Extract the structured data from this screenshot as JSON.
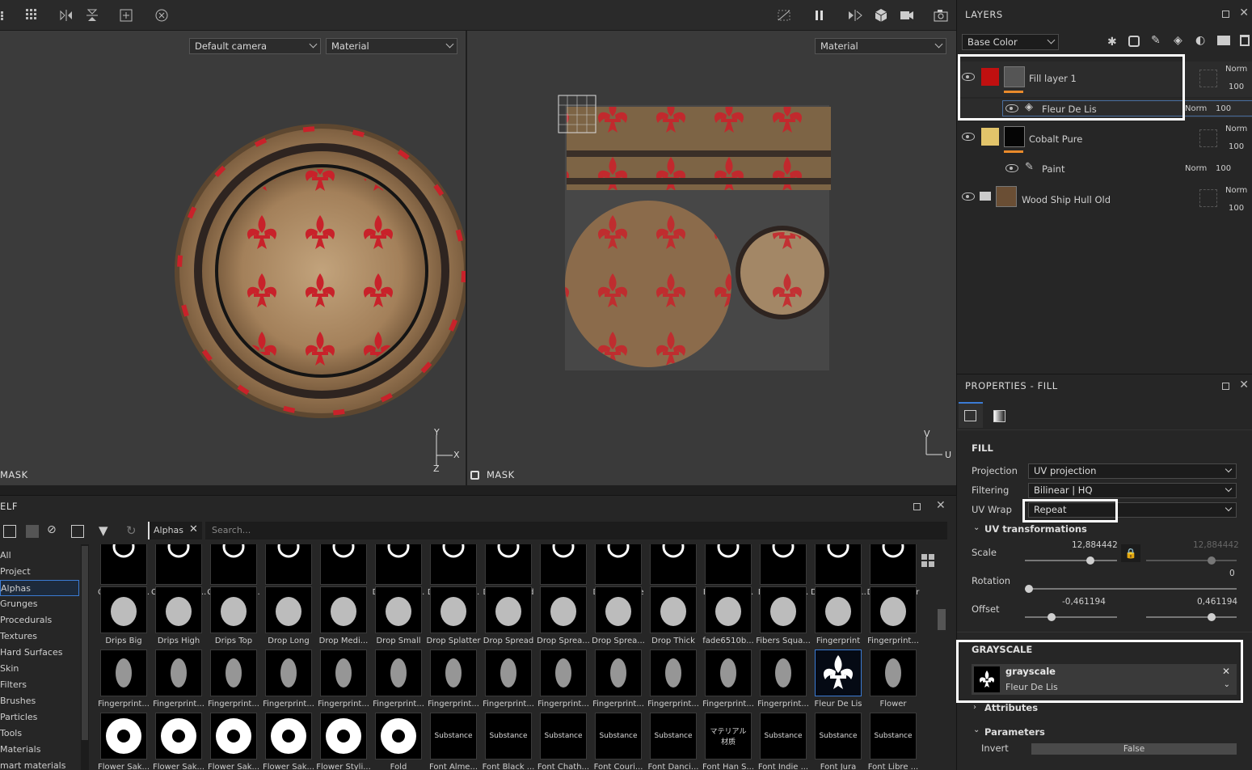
{
  "viewport_left": {
    "camera_select": "Default camera",
    "channel_select": "Material",
    "mask_label": "MASK",
    "axis": {
      "y": "Y",
      "x": "X",
      "z": "Z"
    }
  },
  "viewport_right": {
    "channel_select": "Material",
    "mask_label": "MASK",
    "axis": {
      "v": "V",
      "u": "U"
    }
  },
  "layers": {
    "title": "LAYERS",
    "channel_select": "Base Color",
    "items": [
      {
        "name": "Fill layer 1",
        "blend": "Norm",
        "opacity": "100",
        "color": "#c01010"
      },
      {
        "name": "Fleur De Lis",
        "blend": "Norm",
        "opacity": "100",
        "type": "fill-effect"
      },
      {
        "name": "Cobalt Pure",
        "blend": "Norm",
        "opacity": "100",
        "color": "#e2c46a"
      },
      {
        "name": "Paint",
        "blend": "Norm",
        "opacity": "100",
        "type": "paint-effect"
      },
      {
        "name": "Wood Ship Hull Old",
        "blend": "Norm",
        "opacity": "100",
        "type": "folder"
      }
    ]
  },
  "properties": {
    "title": "PROPERTIES - FILL",
    "fill_section": "FILL",
    "projection_label": "Projection",
    "projection_value": "UV projection",
    "filtering_label": "Filtering",
    "filtering_value": "Bilinear | HQ",
    "uvwrap_label": "UV Wrap",
    "uvwrap_value": "Repeat",
    "uvtrans_label": "UV transformations",
    "scale_label": "Scale",
    "scale_value": "12,884442",
    "scale_value2": "12,884442",
    "rotation_label": "Rotation",
    "rotation_value": "0",
    "offset_label": "Offset",
    "offset_x": "-0,461194",
    "offset_y": "0,461194",
    "grayscale_section": "GRAYSCALE",
    "grayscale_name": "grayscale",
    "grayscale_resource": "Fleur De Lis",
    "attributes_label": "Attributes",
    "parameters_label": "Parameters",
    "invert_label": "Invert",
    "invert_value": "False"
  },
  "shelf": {
    "title": "ELF",
    "filter_tag": "Alphas",
    "search_placeholder": "Search...",
    "categories": [
      "All",
      "Project",
      "Alphas",
      "Grunges",
      "Procedurals",
      "Textures",
      "Hard Surfaces",
      "Skin",
      "Filters",
      "Brushes",
      "Particles",
      "Tools",
      "Materials",
      "mart materials"
    ],
    "selected_category": "Alphas",
    "rows": [
      [
        "Cross Medi...",
        "Cross Recta...",
        "Cross Roun...",
        "Cross Split",
        "Cross Thin",
        "Diagonal D...",
        "Dirt Blurry ...",
        "Dirt Brushed",
        "Dirt Cloudy",
        "Dirt Smudge",
        "Dirt Spots",
        "Dirt Spots ...",
        "Dirt Spots ...",
        "Dirt Stain la...",
        "Dots Circular"
      ],
      [
        "Drips Big",
        "Drips High",
        "Drips Top",
        "Drop Long",
        "Drop Medi...",
        "Drop Small",
        "Drop Splatter",
        "Drop Spread",
        "Drop Sprea...",
        "Drop Sprea...",
        "Drop Thick",
        "fade6510b...",
        "Fibers Squa...",
        "Fingerprint",
        "Fingerprint..."
      ],
      [
        "Fingerprint...",
        "Fingerprint...",
        "Fingerprint...",
        "Fingerprint...",
        "Fingerprint...",
        "Fingerprint...",
        "Fingerprint...",
        "Fingerprint...",
        "Fingerprint...",
        "Fingerprint...",
        "Fingerprint...",
        "Fingerprint...",
        "Fingerprint...",
        "Fleur De Lis",
        "Flower"
      ],
      [
        "Flower Sak...",
        "Flower Sak...",
        "Flower Sak...",
        "Flower Sak...",
        "Flower Styli...",
        "Fold",
        "Font Alme...",
        "Font Black ...",
        "Font Chath...",
        "Font Couri...",
        "Font Danci...",
        "Font Han S...",
        "Font Indie ...",
        "Font Jura",
        "Font Libre ..."
      ]
    ],
    "font_thumbs": [
      "Substance",
      "Substance",
      "Substance",
      "Substance",
      "Substance",
      "マテリアル 材质",
      "Substance",
      "Substance",
      "Substance"
    ]
  }
}
